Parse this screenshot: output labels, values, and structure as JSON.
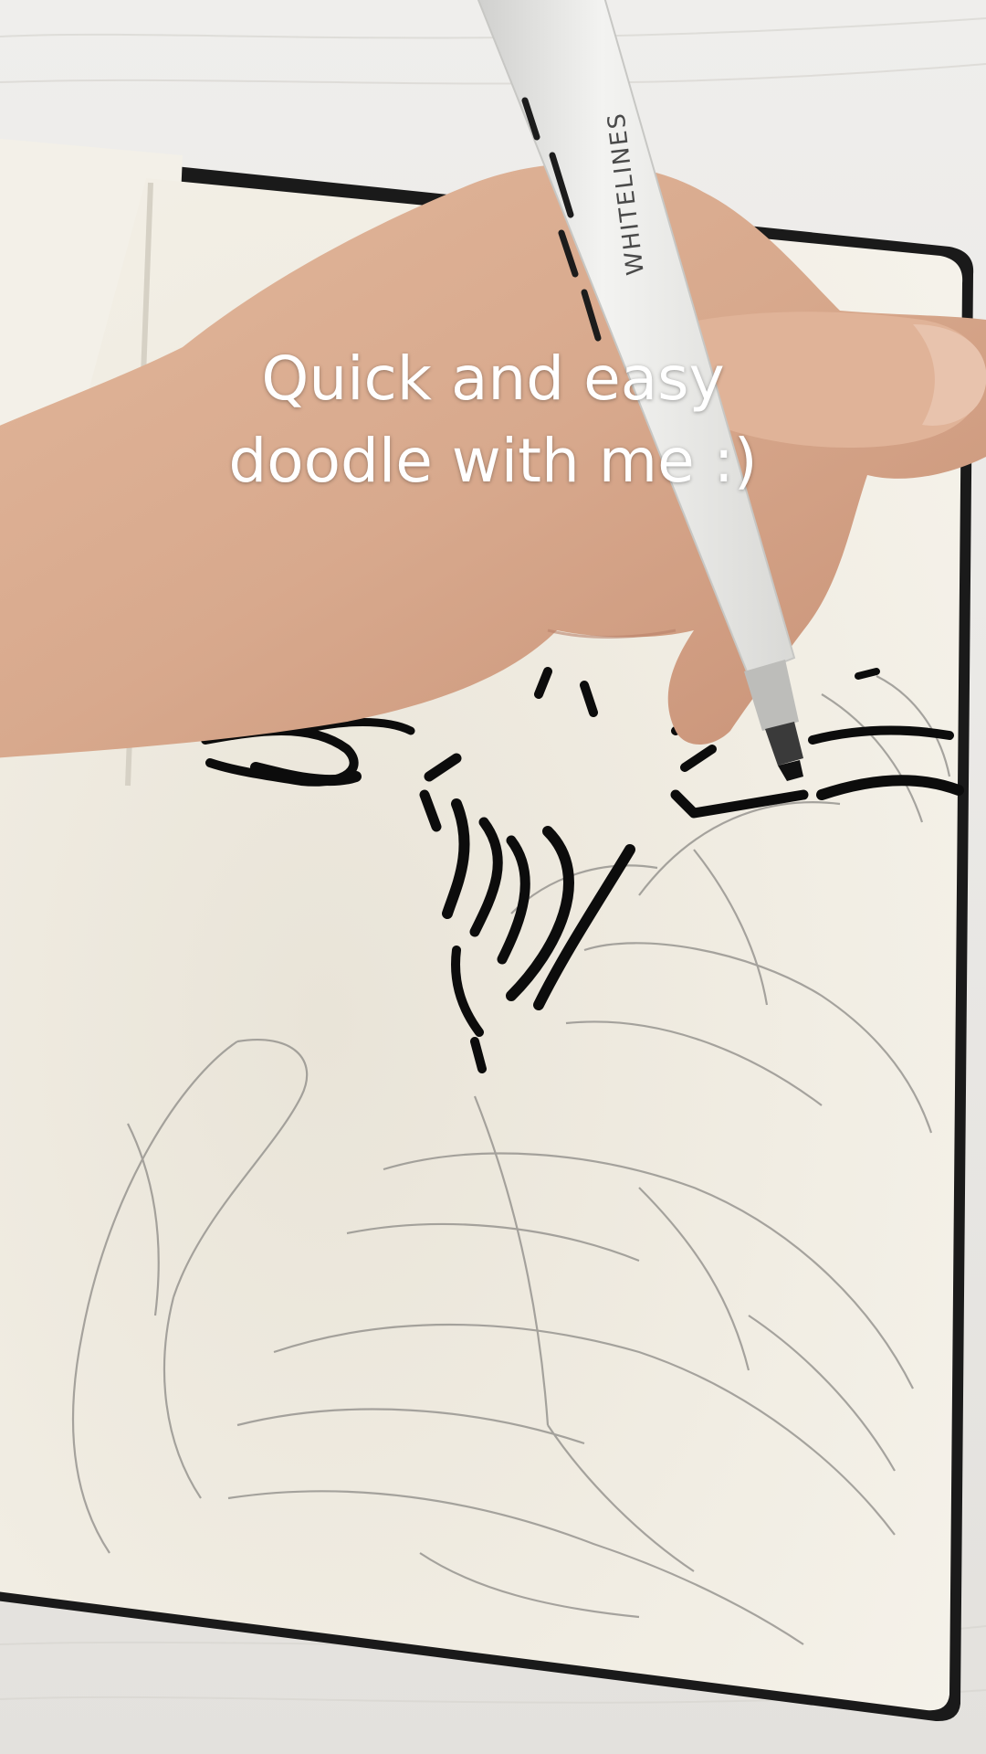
{
  "caption": {
    "line1": "Quick and easy",
    "line2": "doodle with me :)"
  },
  "pen": {
    "brand_text": "WHITELINES"
  },
  "colors": {
    "table": "#e9e7e3",
    "paper": "#f1ede3",
    "ink": "#0c0c0c",
    "pencil": "#8c8a86",
    "skin": "#d9ab8f",
    "pen_body": "#e6e6e4",
    "caption_text": "#ffffff"
  }
}
